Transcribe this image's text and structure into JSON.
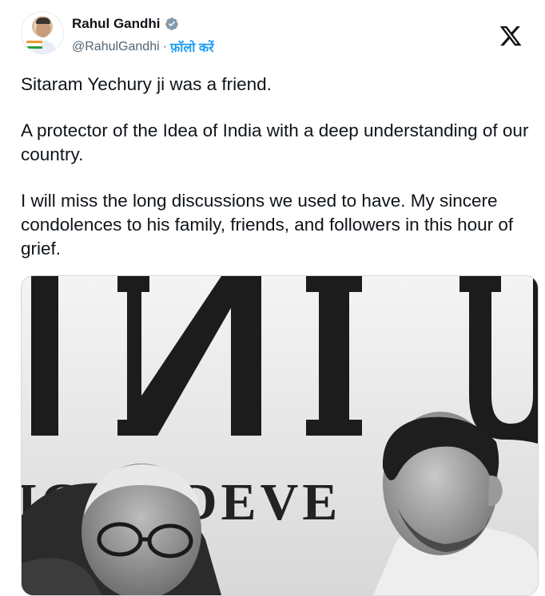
{
  "author": {
    "name": "Rahul Gandhi",
    "handle": "@RahulGandhi",
    "separator": "·",
    "follow_label": "फ़ॉलो करें",
    "avatar_icon": "profile-photo-avatar",
    "verified_icon": "verified-badge-icon",
    "verified_color": "#829aab"
  },
  "platform": {
    "logo_icon": "x-logo-icon"
  },
  "tweet": {
    "paragraphs": [
      "Sitaram Yechury ji was a friend.",
      "A protector of the Idea of India with a deep understanding of our country.",
      "I will miss the long discussions we used to have. My sincere condolences to his family, friends, and followers in this hour of grief."
    ]
  },
  "media": {
    "type": "black-and-white photo",
    "banner_text": "ICAL DEVE"
  },
  "colors": {
    "text_primary": "#0f1419",
    "text_secondary": "#536471",
    "link": "#1d9bf0",
    "border": "#cfd9de"
  }
}
